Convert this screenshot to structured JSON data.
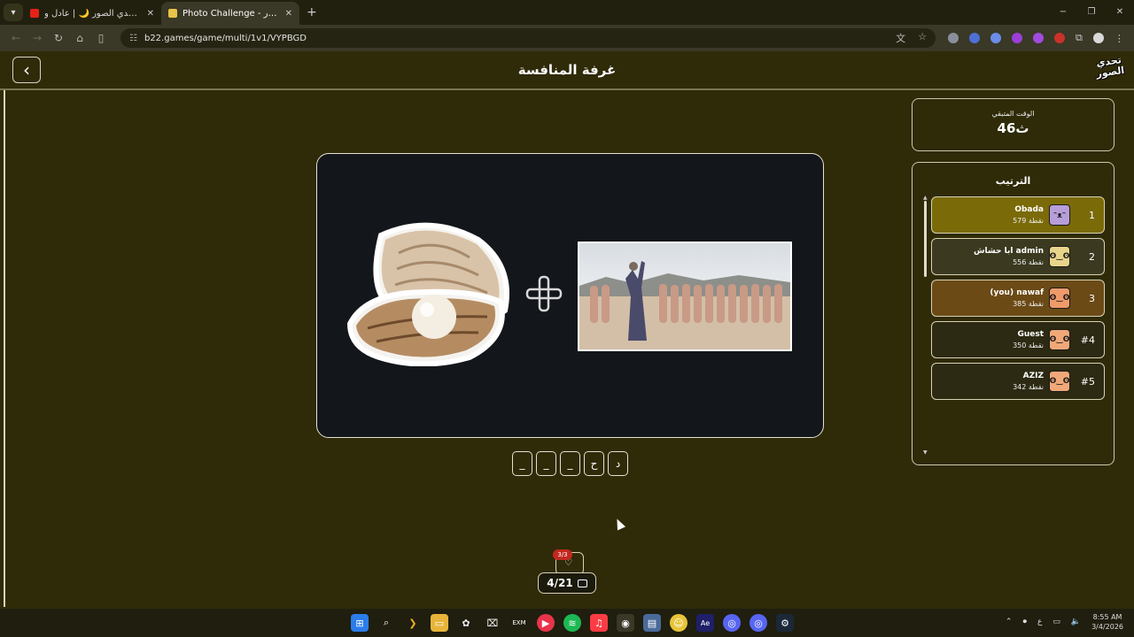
{
  "browser": {
    "tabs": [
      {
        "title": "بطولة تحدي الصور 🌙 | عادل و...",
        "active": false,
        "favicon_color": "#e62117"
      },
      {
        "title": "Photo Challenge - تحدي الصور",
        "active": true,
        "favicon_color": "#e8c34a"
      }
    ],
    "new_tab": "+",
    "url": "b22.games/game/multi/1v1/VYPBGD",
    "window_controls": [
      "−",
      "❐",
      "✕"
    ]
  },
  "header": {
    "title": "غرفة المنافسة",
    "back_icon": "‹",
    "logo": "تحدي الصور"
  },
  "timer": {
    "label": "الوقت المتبقي",
    "value": "46ث"
  },
  "ranking": {
    "title": "الترتيب",
    "rows": [
      {
        "pos": "1",
        "name": "Obada",
        "points": "579 نقطة",
        "bg": "#7a6a08",
        "avatar_bg": "#b79ed8"
      },
      {
        "pos": "2",
        "name": "ابا حشاش admin",
        "points": "556 نقطة",
        "bg": "#3b3a20",
        "avatar_bg": "#e9d58a"
      },
      {
        "pos": "3",
        "name": "(you) nawaf",
        "points": "385 نقطة",
        "bg": "#6b4a16",
        "avatar_bg": "#ef9a6a"
      },
      {
        "pos": "#4",
        "name": "Guest",
        "points": "350 نقطة",
        "bg": "#2c2a12",
        "avatar_bg": "#f0a878"
      },
      {
        "pos": "#5",
        "name": "AZIZ",
        "points": "342 نقطة",
        "bg": "#2c2a12",
        "avatar_bg": "#f0a878"
      }
    ]
  },
  "answer_slots": [
    "_",
    "_",
    "_",
    "ح",
    "د"
  ],
  "hints": {
    "badge": "3/3"
  },
  "round": {
    "value": "4/21"
  },
  "taskbar": {
    "time": "8:55 AM",
    "date": "3/4/2026",
    "lang": "ع"
  }
}
